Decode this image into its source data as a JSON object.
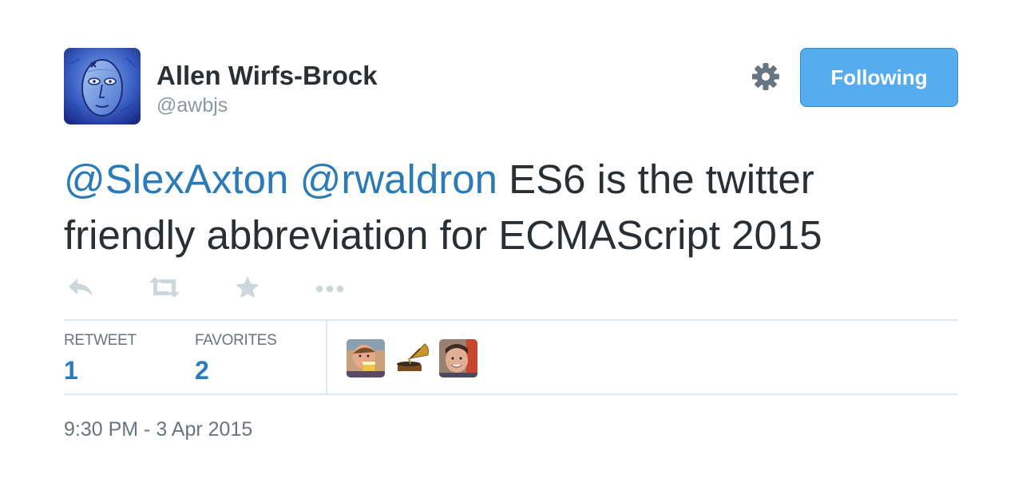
{
  "tweet": {
    "author": {
      "name": "Allen Wirfs-Brock",
      "handle": "@awbjs",
      "avatar_icon": "blue-mask-face-avatar"
    },
    "follow_button_label": "Following",
    "settings_icon": "gear-icon",
    "text": {
      "mention_1": "@SlexAxton",
      "mention_2": "@rwaldron",
      "body": " ES6 is the twitter friendly abbreviation for ECMAScript 2015"
    },
    "actions": [
      {
        "name": "reply",
        "icon": "reply-icon"
      },
      {
        "name": "retweet",
        "icon": "retweet-icon"
      },
      {
        "name": "favorite",
        "icon": "star-icon"
      },
      {
        "name": "more",
        "icon": "ellipsis-icon"
      }
    ],
    "stats": {
      "retweets_label": "RETWEET",
      "retweets_count": "1",
      "favorites_label": "FAVORITES",
      "favorites_count": "2"
    },
    "favorited_by_avatars": [
      "person-with-beer-avatar",
      "gramophone-avatar",
      "smiling-man-avatar"
    ],
    "timestamp": "9:30 PM - 3 Apr 2015"
  },
  "colors": {
    "text": "#292f33",
    "link": "#2b7bb9",
    "muted": "#8899a6",
    "button_bg": "#55acee",
    "divider": "#e1e8ed",
    "action_icon": "#ccd6dd"
  }
}
